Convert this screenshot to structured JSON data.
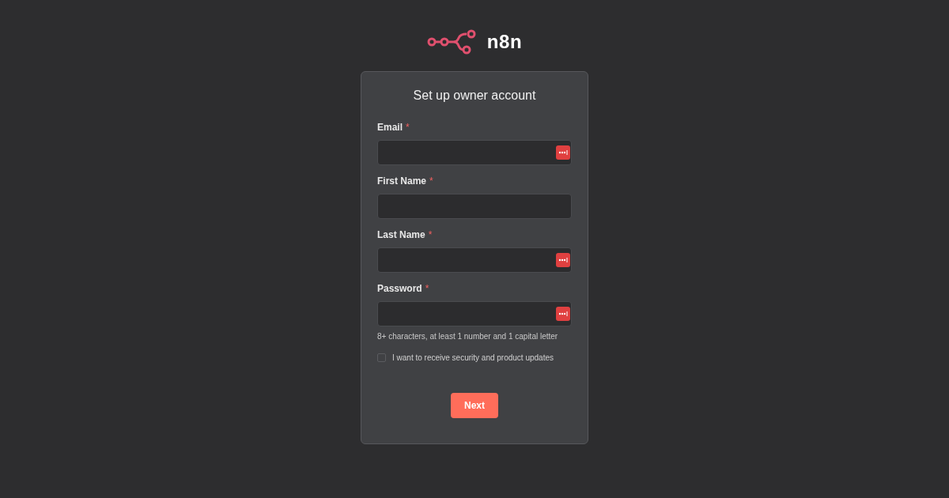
{
  "logo": {
    "text": "n8n"
  },
  "card": {
    "title": "Set up owner account"
  },
  "fields": [
    {
      "label": "Email",
      "required_mark": "*",
      "manager_icon": true
    },
    {
      "label": "First Name",
      "required_mark": "*",
      "manager_icon": false
    },
    {
      "label": "Last Name",
      "required_mark": "*",
      "manager_icon": true
    },
    {
      "label": "Password",
      "required_mark": "*",
      "manager_icon": true,
      "hint": "8+ characters, at least 1 number and 1 capital letter"
    }
  ],
  "checkbox": {
    "label": "I want to receive security and product updates",
    "checked": false
  },
  "button": {
    "label": "Next"
  }
}
